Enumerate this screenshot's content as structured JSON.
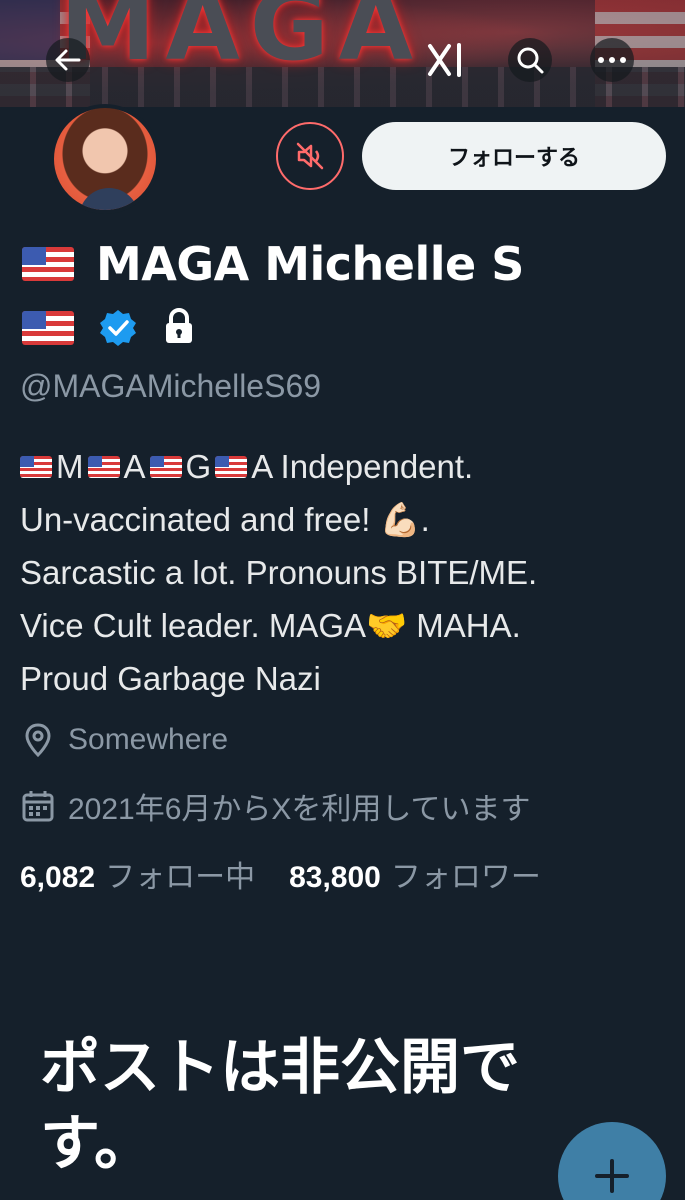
{
  "banner": {
    "text": "MAGA"
  },
  "nav": {
    "back_icon": "arrow-left-icon",
    "xai_icon": "xai-grok-icon",
    "search_icon": "search-icon",
    "more_icon": "more-horizontal-icon"
  },
  "profile": {
    "follow_label": "フォローする",
    "mute_icon": "muted-speaker-icon",
    "display_name": "MAGA Michelle S",
    "handle": "@MAGAMichelleS69",
    "verified_color": "#1d9bf0",
    "bio": {
      "line1_letters": [
        "M",
        "A",
        "G",
        "A Independent."
      ],
      "line2": "Un-vaccinated and free! 💪🏻.",
      "line3": "Sarcastic a lot. Pronouns BITE/ME.",
      "line4": "Vice Cult leader. MAGA🤝 MAHA.",
      "line5": "Proud Garbage Nazi"
    },
    "location": "Somewhere",
    "joined": "2021年6月からXを利用しています",
    "following_count": "6,082",
    "following_label": "フォロー中",
    "followers_count": "83,800",
    "followers_label": "フォロワー"
  },
  "private_notice": "ポストは非公開です。",
  "fab": {
    "icon": "plus-icon"
  },
  "colors": {
    "background": "#15202b",
    "mute_accent": "#ff6b6b",
    "fab": "#3f7fa6"
  }
}
